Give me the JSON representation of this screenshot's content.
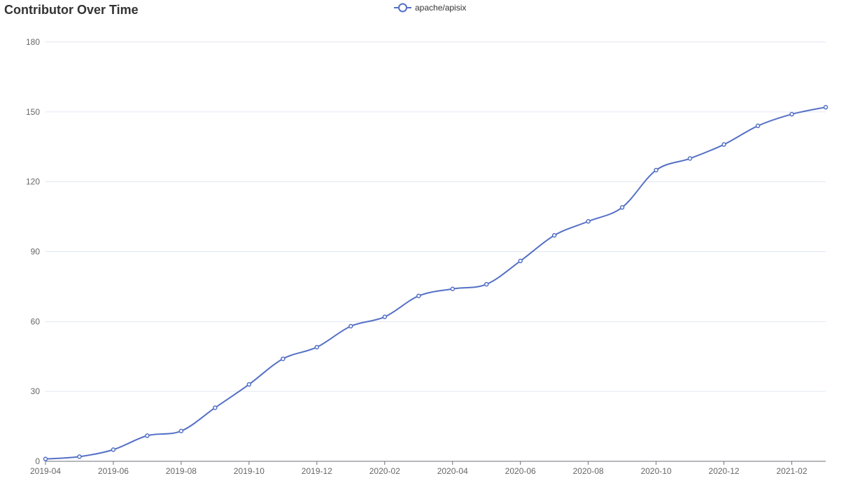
{
  "chart_data": {
    "type": "line",
    "title": "Contributor Over Time",
    "xlabel": "",
    "ylabel": "",
    "ylim": [
      0,
      180
    ],
    "y_ticks": [
      0,
      30,
      60,
      90,
      120,
      150,
      180
    ],
    "x_tick_labels": [
      "2019-04",
      "2019-06",
      "2019-08",
      "2019-10",
      "2019-12",
      "2020-02",
      "2020-04",
      "2020-06",
      "2020-08",
      "2020-10",
      "2020-12",
      "2021-02"
    ],
    "grid": true,
    "legend_position": "top-center",
    "series": [
      {
        "name": "apache/apisix",
        "color": "#5470c6",
        "x": [
          "2019-04",
          "2019-05",
          "2019-06",
          "2019-07",
          "2019-08",
          "2019-09",
          "2019-10",
          "2019-11",
          "2019-12",
          "2020-01",
          "2020-02",
          "2020-03",
          "2020-04",
          "2020-05",
          "2020-06",
          "2020-07",
          "2020-08",
          "2020-09",
          "2020-10",
          "2020-11",
          "2020-12",
          "2021-01",
          "2021-02",
          "2021-03"
        ],
        "values": [
          1,
          2,
          5,
          11,
          13,
          23,
          33,
          44,
          49,
          58,
          62,
          71,
          74,
          76,
          86,
          97,
          103,
          109,
          125,
          130,
          136,
          144,
          149,
          152
        ]
      }
    ]
  }
}
